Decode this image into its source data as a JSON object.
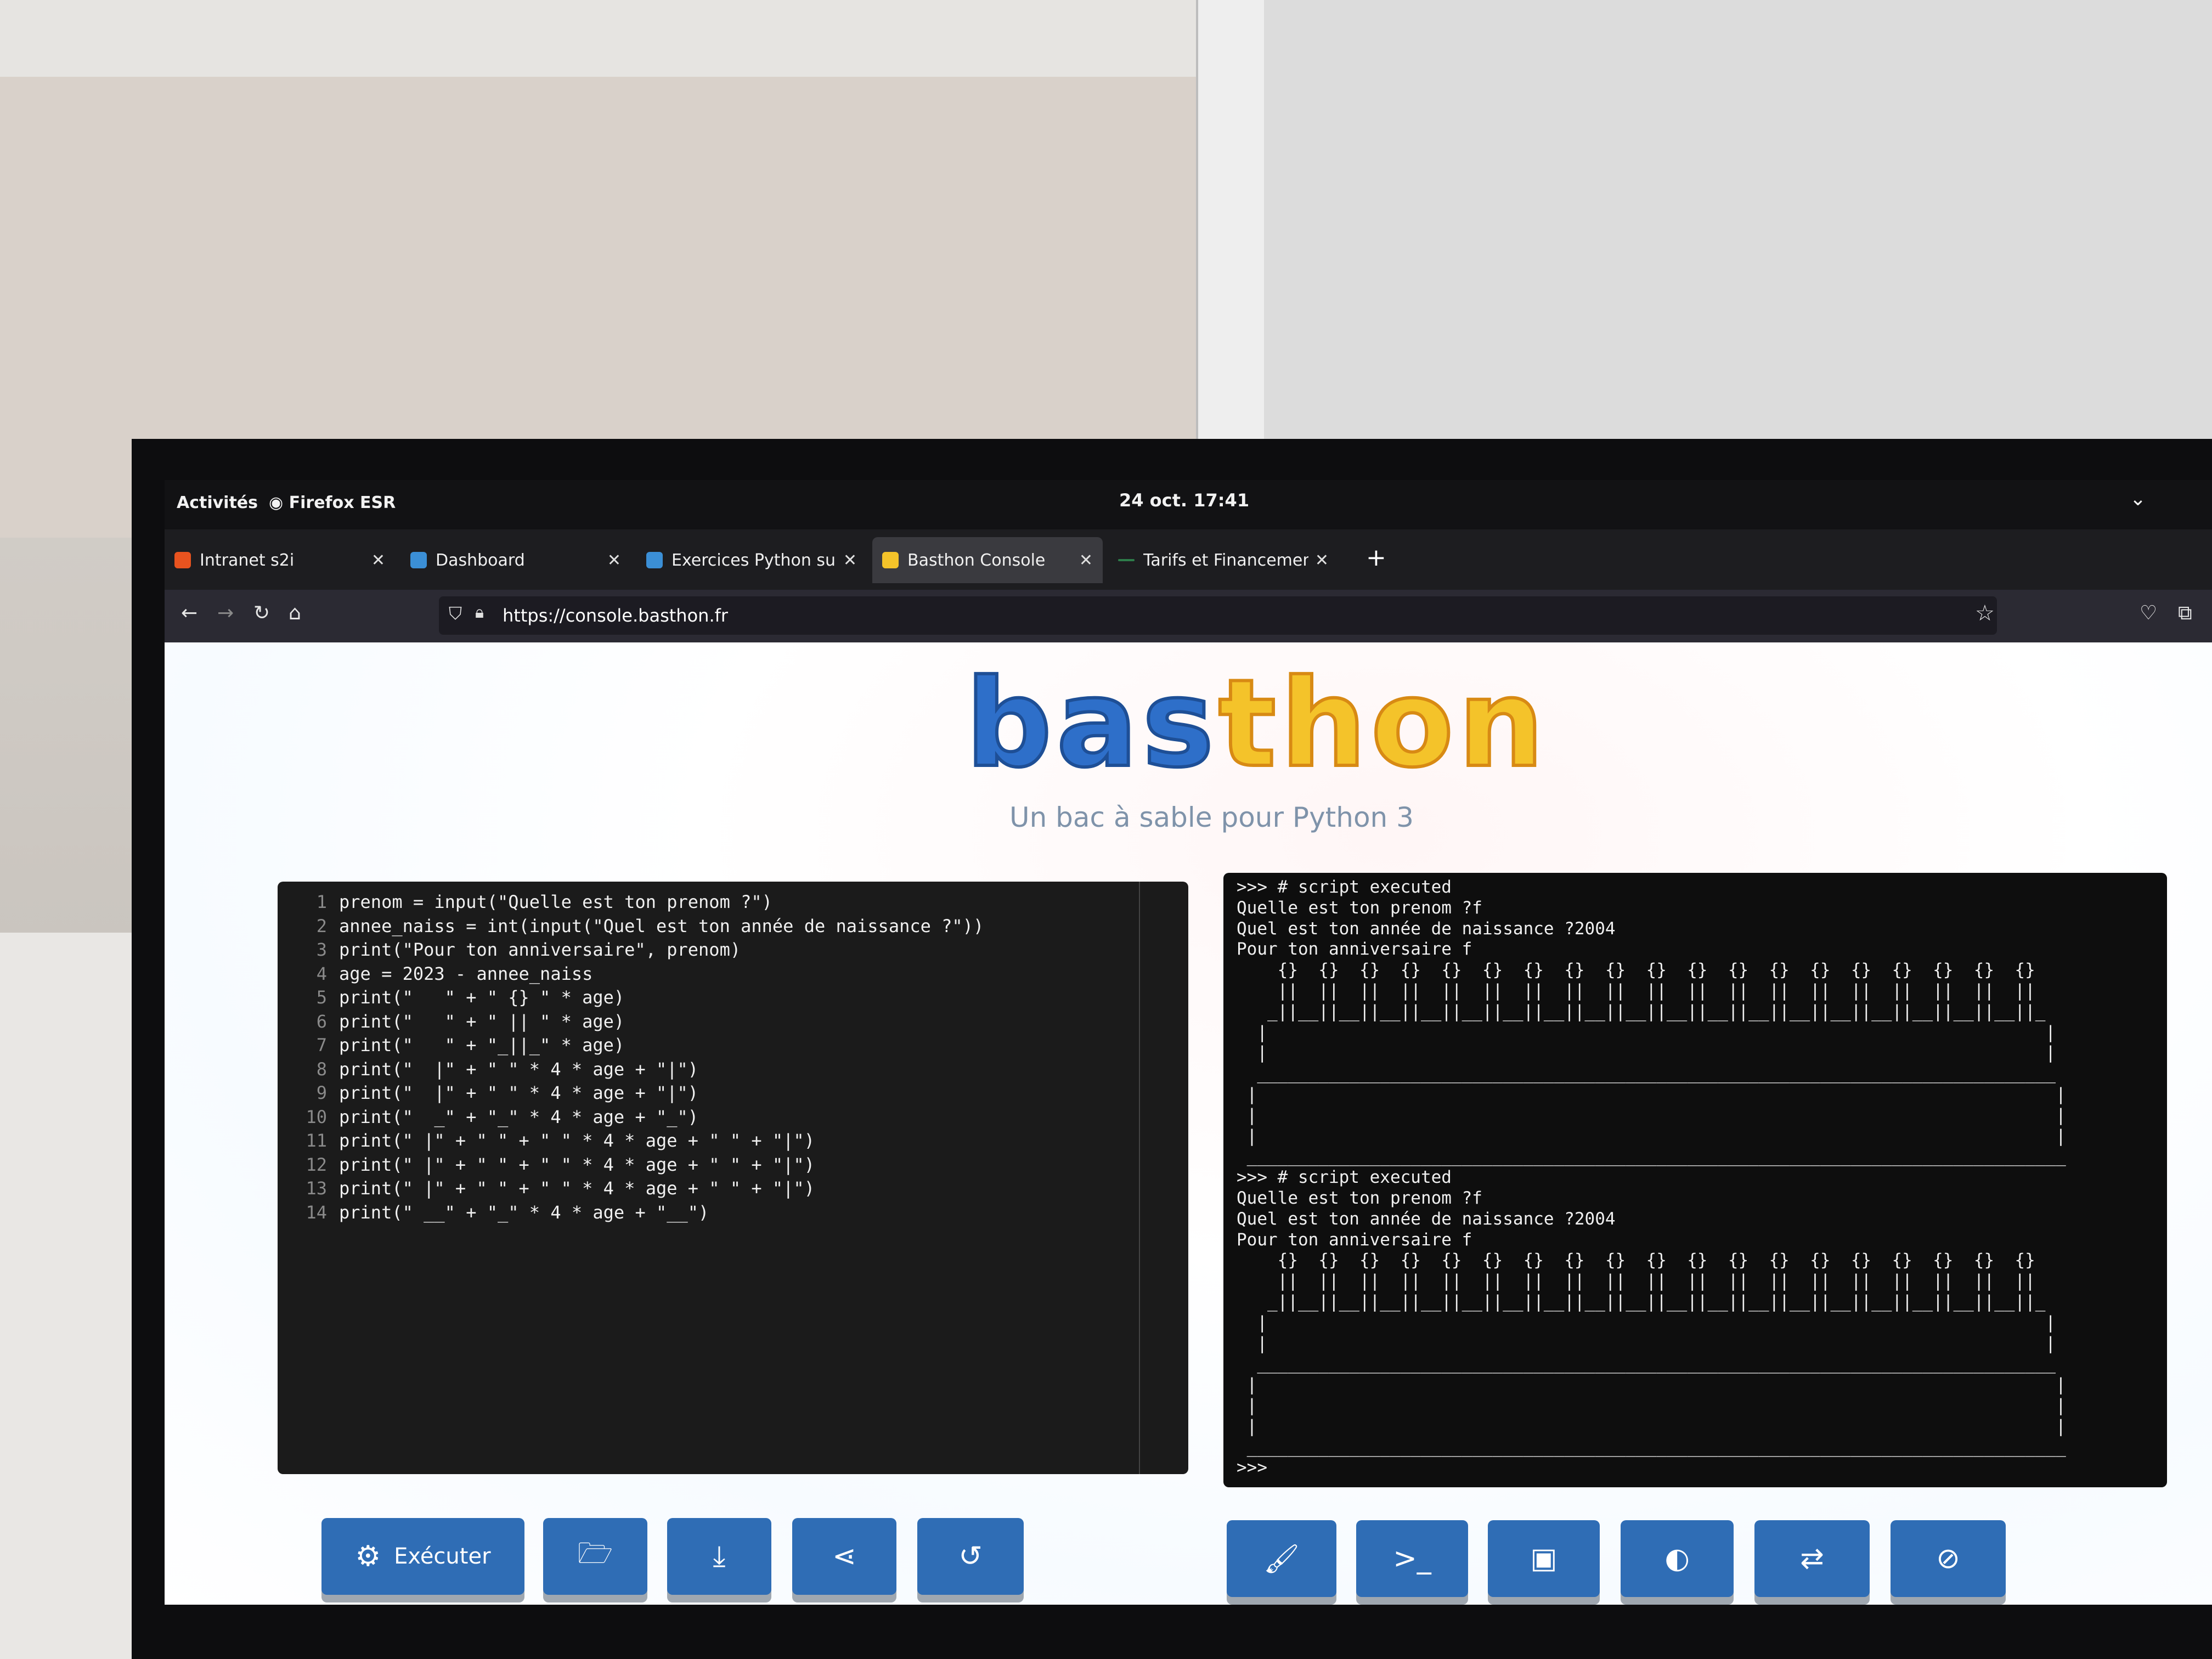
{
  "gnome": {
    "activities": "Activités",
    "app": "Firefox ESR",
    "clock": "24 oct.  17:41"
  },
  "tabs": [
    {
      "label": "Intranet s2i",
      "fav_color": "#e8531f"
    },
    {
      "label": "Dashboard",
      "fav_color": "#3b8fd6"
    },
    {
      "label": "Exercices Python sur les v",
      "fav_color": "#3b8fd6"
    },
    {
      "label": "Basthon Console",
      "fav_color": "#f4c32a"
    },
    {
      "label": "Tarifs et Financements - E",
      "fav_color": "#1d1d20"
    }
  ],
  "nav": {
    "url": "https://console.basthon.fr"
  },
  "page": {
    "logo_part1": "bas",
    "logo_part2": "thon",
    "tagline": "Un bac à sable pour Python 3"
  },
  "editor": {
    "lines": [
      {
        "n": "1",
        "text": "prenom = input(\"Quelle est ton prenom ?\")"
      },
      {
        "n": "2",
        "text": "annee_naiss = int(input(\"Quel est ton année de naissance ?\"))"
      },
      {
        "n": "3",
        "text": "print(\"Pour ton anniversaire\", prenom)"
      },
      {
        "n": "4",
        "text": "age = 2023 - annee_naiss"
      },
      {
        "n": "5",
        "text": "print(\"   \" + \" {} \" * age)"
      },
      {
        "n": "6",
        "text": "print(\"   \" + \" || \" * age)"
      },
      {
        "n": "7",
        "text": "print(\"   \" + \"_||_\" * age)"
      },
      {
        "n": "8",
        "text": "print(\"  |\" + \" \" * 4 * age + \"|\")"
      },
      {
        "n": "9",
        "text": "print(\"  |\" + \" \" * 4 * age + \"|\")"
      },
      {
        "n": "10",
        "text": "print(\"  _\" + \"_\" * 4 * age + \"_\")"
      },
      {
        "n": "11",
        "text": "print(\" |\" + \" \" + \" \" * 4 * age + \" \" + \"|\")"
      },
      {
        "n": "12",
        "text": "print(\" |\" + \" \" + \" \" * 4 * age + \" \" + \"|\")"
      },
      {
        "n": "13",
        "text": "print(\" |\" + \" \" + \" \" * 4 * age + \" \" + \"|\")"
      },
      {
        "n": "14",
        "text": "print(\" __\" + \"_\" * 4 * age + \"__\")"
      }
    ]
  },
  "console": {
    "lines": [
      ">>> # script executed",
      "Quelle est ton prenom ?f",
      "Quel est ton année de naissance ?2004",
      "Pour ton anniversaire f",
      "    {}  {}  {}  {}  {}  {}  {}  {}  {}  {}  {}  {}  {}  {}  {}  {}  {}  {}  {}",
      "    ||  ||  ||  ||  ||  ||  ||  ||  ||  ||  ||  ||  ||  ||  ||  ||  ||  ||  ||",
      "   _||__||__||__||__||__||__||__||__||__||__||__||__||__||__||__||__||__||__||_",
      "  |                                                                            |",
      "  |                                                                            |",
      "  ______________________________________________________________________________",
      " |                                                                              |",
      " |                                                                              |",
      " |                                                                              |",
      " ________________________________________________________________________________",
      ">>> # script executed",
      "Quelle est ton prenom ?f",
      "Quel est ton année de naissance ?2004",
      "Pour ton anniversaire f",
      "    {}  {}  {}  {}  {}  {}  {}  {}  {}  {}  {}  {}  {}  {}  {}  {}  {}  {}  {}",
      "    ||  ||  ||  ||  ||  ||  ||  ||  ||  ||  ||  ||  ||  ||  ||  ||  ||  ||  ||",
      "   _||__||__||__||__||__||__||__||__||__||__||__||__||__||__||__||__||__||__||_",
      "  |                                                                            |",
      "  |                                                                            |",
      "  ______________________________________________________________________________",
      " |                                                                              |",
      " |                                                                              |",
      " |                                                                              |",
      " ________________________________________________________________________________",
      ">>>"
    ]
  },
  "toolbar_left": {
    "run_label": "Exécuter",
    "icons": [
      "gears-icon",
      "folder-open-icon",
      "download-icon",
      "share-icon",
      "undo-icon"
    ]
  },
  "toolbar_right": {
    "icons": [
      "broom-icon",
      "terminal-icon",
      "image-icon",
      "contrast-icon",
      "swap-icon",
      "eye-slash-icon"
    ]
  }
}
